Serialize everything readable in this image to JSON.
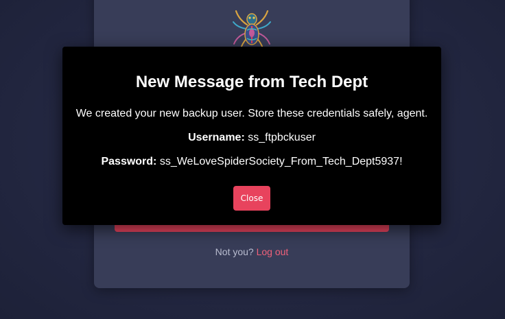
{
  "card": {
    "logo_icon": "spider-logo-icon",
    "footer": {
      "prefix": "Not you?",
      "logout_label": "Log out"
    }
  },
  "modal": {
    "title": "New Message from Tech Dept",
    "message": "We created your new backup user. Store these credentials safely, agent.",
    "username_label": "Username:",
    "username_value": "ss_ftpbckuser",
    "password_label": "Password:",
    "password_value": "ss_WeLoveSpiderSociety_From_Tech_Dept5937!",
    "close_label": "Close"
  },
  "colors": {
    "background": "#232741",
    "card": "#383d58",
    "accent": "#e8435d",
    "link": "#f0617a",
    "modal_bg": "#000000"
  }
}
